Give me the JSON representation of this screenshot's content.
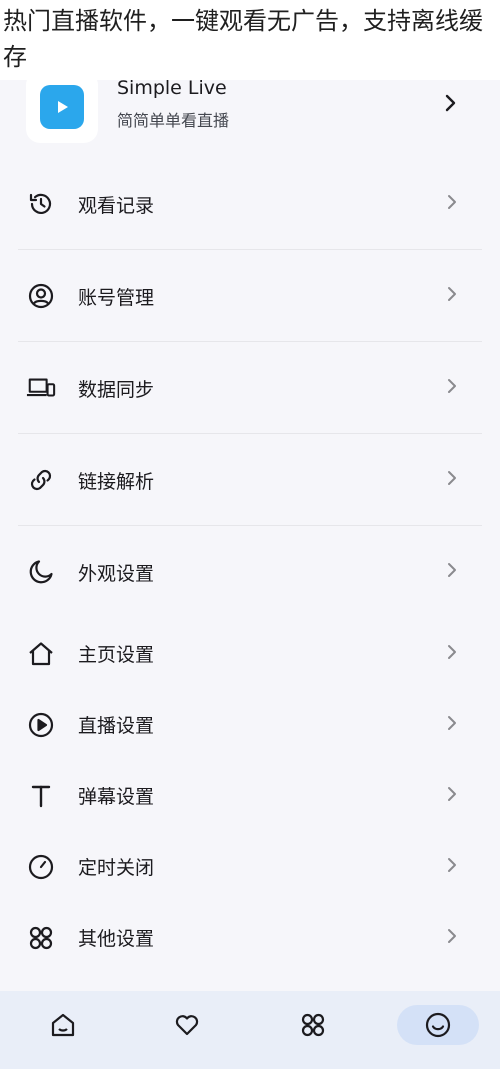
{
  "overlay": {
    "caption": "热门直播软件，一键观看无广告，支持离线缓存"
  },
  "header": {
    "app_name": "Simple Live",
    "tagline": "简简单单看直播",
    "logo_icon": "play-icon",
    "logo_color": "#2ba7ec"
  },
  "menu": {
    "items": [
      {
        "label": "观看记录",
        "icon": "history-icon"
      },
      {
        "label": "账号管理",
        "icon": "account-icon"
      },
      {
        "label": "数据同步",
        "icon": "devices-icon"
      },
      {
        "label": "链接解析",
        "icon": "link-icon"
      },
      {
        "label": "外观设置",
        "icon": "moon-icon"
      },
      {
        "label": "主页设置",
        "icon": "home-icon"
      },
      {
        "label": "直播设置",
        "icon": "play-circle-icon"
      },
      {
        "label": "弹幕设置",
        "icon": "text-icon"
      },
      {
        "label": "定时关闭",
        "icon": "timer-icon"
      },
      {
        "label": "其他设置",
        "icon": "apps-icon"
      }
    ]
  },
  "bottom_nav": {
    "items": [
      {
        "icon": "home-icon",
        "active": false
      },
      {
        "icon": "heart-icon",
        "active": false
      },
      {
        "icon": "apps-icon",
        "active": false
      },
      {
        "icon": "smile-icon",
        "active": true
      }
    ],
    "active_color": "#d4e1f7"
  }
}
